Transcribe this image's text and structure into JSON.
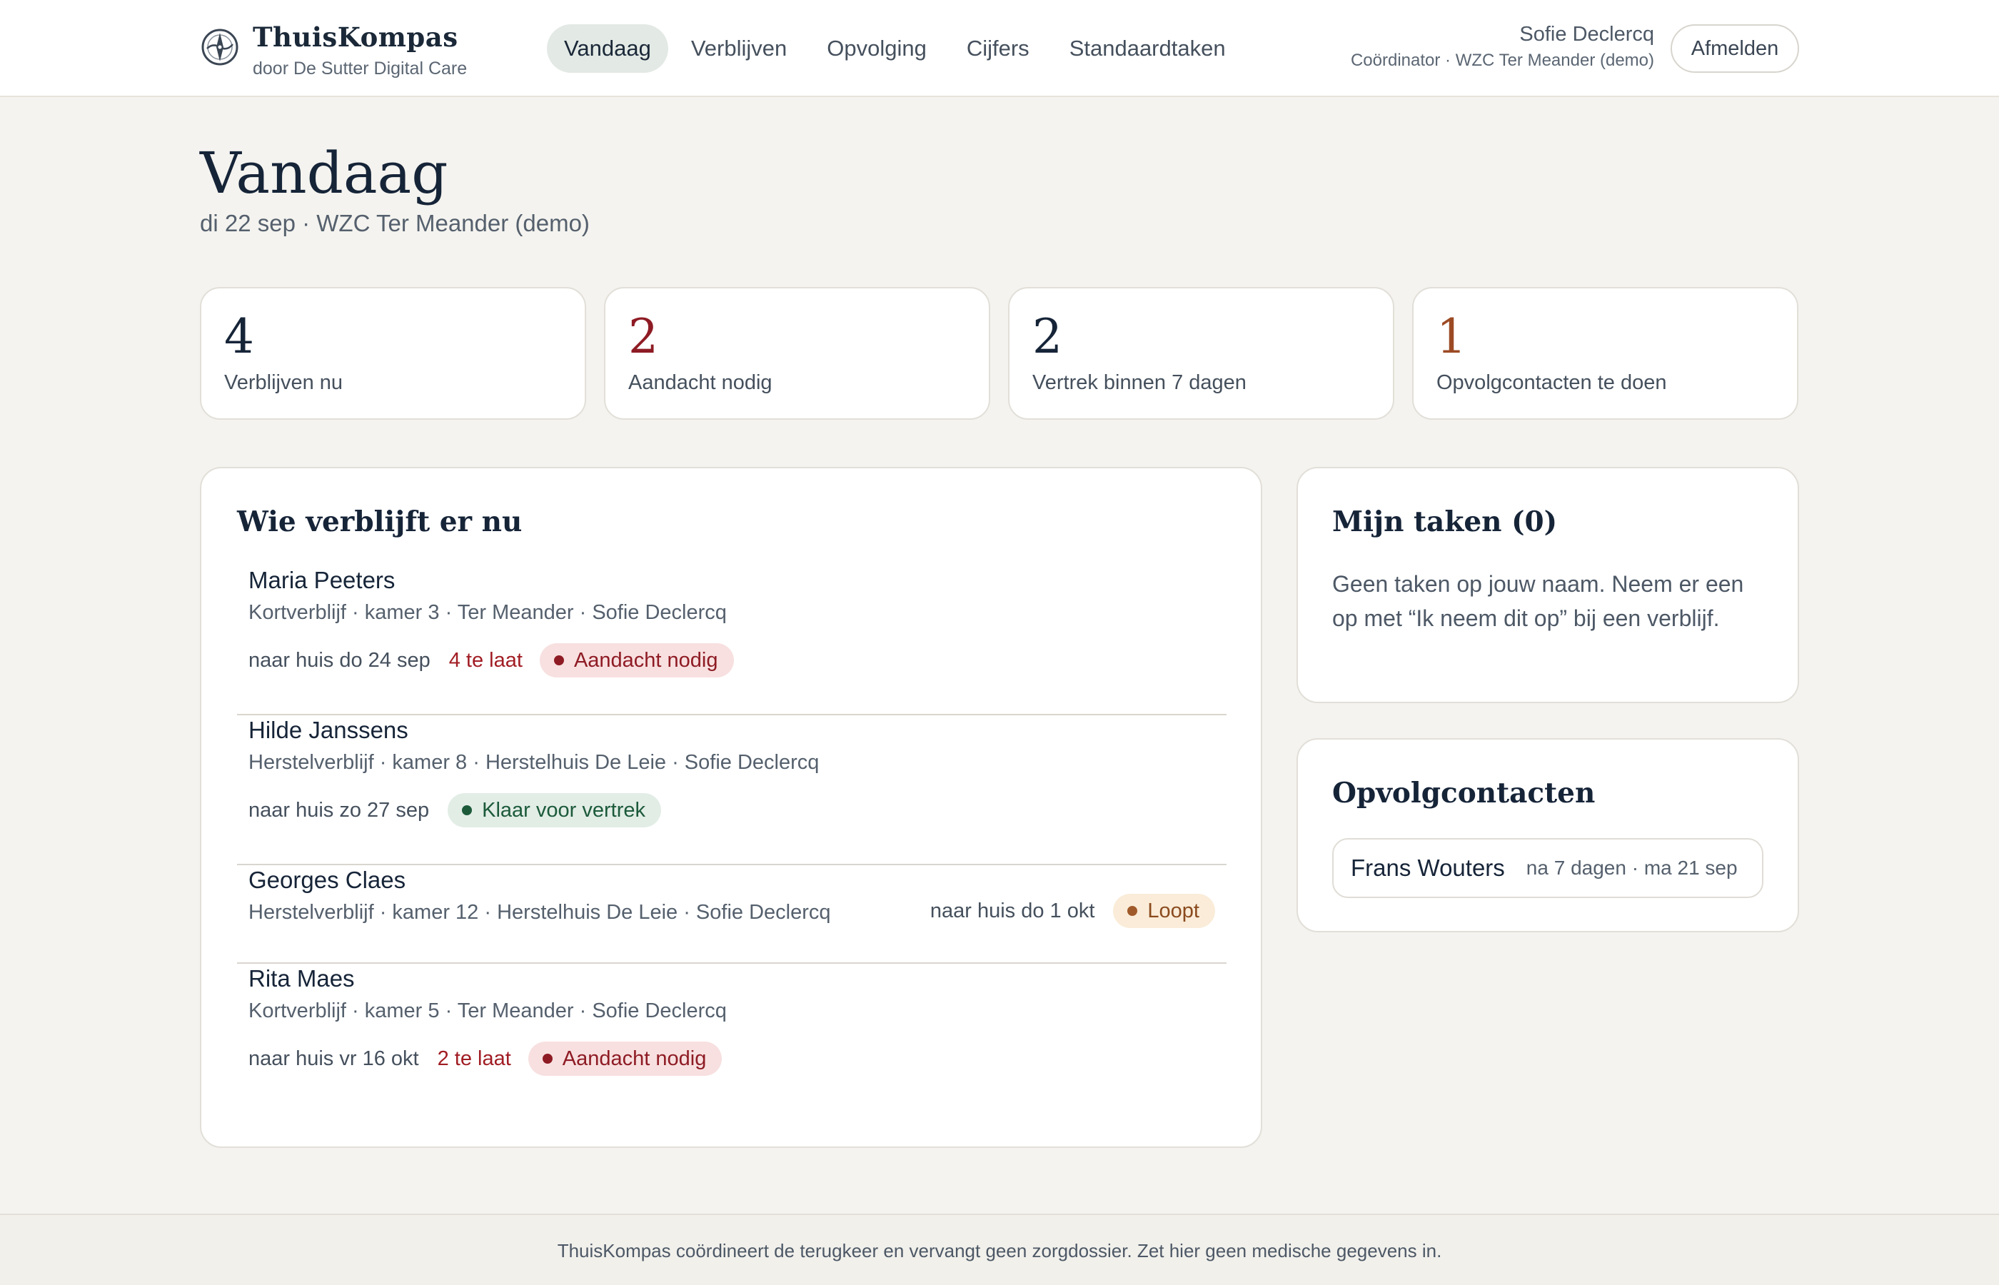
{
  "header": {
    "brand_name": "ThuisKompas",
    "brand_sub": "door De Sutter Digital Care",
    "logo_icon": "compass-icon",
    "nav": [
      {
        "label": "Vandaag",
        "active": true
      },
      {
        "label": "Verblijven",
        "active": false
      },
      {
        "label": "Opvolging",
        "active": false
      },
      {
        "label": "Cijfers",
        "active": false
      },
      {
        "label": "Standaardtaken",
        "active": false
      }
    ],
    "user_name": "Sofie Declercq",
    "user_role": "Coördinator · WZC Ter Meander (demo)",
    "logout_label": "Afmelden"
  },
  "page": {
    "title": "Vandaag",
    "subtitle": "di 22 sep · WZC Ter Meander (demo)"
  },
  "stats": [
    {
      "value": "4",
      "label": "Verblijven nu",
      "color": "#162438"
    },
    {
      "value": "2",
      "label": "Aandacht nodig",
      "color": "#8e1b24"
    },
    {
      "value": "2",
      "label": "Vertrek binnen 7 dagen",
      "color": "#162438"
    },
    {
      "value": "1",
      "label": "Opvolgcontacten te doen",
      "color": "#9c4a24"
    }
  ],
  "stays": {
    "title": "Wie verblijft er nu",
    "items": [
      {
        "name": "Maria Peeters",
        "meta": "Kortverblijf · kamer 3 · Ter Meander · Sofie Declercq",
        "date": "naar huis do 24 sep",
        "late": "4 te laat",
        "badge": "Aandacht nodig",
        "status": "attn"
      },
      {
        "name": "Hilde Janssens",
        "meta": "Herstelverblijf · kamer 8 · Herstelhuis De Leie · Sofie Declercq",
        "date": "naar huis zo 27 sep",
        "late": "",
        "badge": "Klaar voor vertrek",
        "status": "ready"
      },
      {
        "name": "Georges Claes",
        "meta": "Herstelverblijf · kamer 12 · Herstelhuis De Leie · Sofie Declercq",
        "date": "naar huis do 1 okt",
        "late": "",
        "badge": "Loopt",
        "status": "run"
      },
      {
        "name": "Rita Maes",
        "meta": "Kortverblijf · kamer 5 · Ter Meander · Sofie Declercq",
        "date": "naar huis vr 16 okt",
        "late": "2 te laat",
        "badge": "Aandacht nodig",
        "status": "attn"
      }
    ]
  },
  "tasks": {
    "title": "Mijn taken (0)",
    "empty_text": "Geen taken op jouw naam. Neem er een op met “Ik neem dit op” bij een verblijf."
  },
  "followups": {
    "title": "Opvolgcontacten",
    "items": [
      {
        "name": "Frans Wouters",
        "when": "na 7 dagen · ma 21 sep"
      }
    ]
  },
  "footer": {
    "text": "ThuisKompas coördineert de terugkeer en vervangt geen zorgdossier. Zet hier geen medische gegevens in."
  },
  "colors": {
    "accent_attention": "#8e1b24",
    "accent_ready": "#1c5a3a",
    "accent_running": "#a05a2a",
    "background": "#f4f3ef"
  }
}
